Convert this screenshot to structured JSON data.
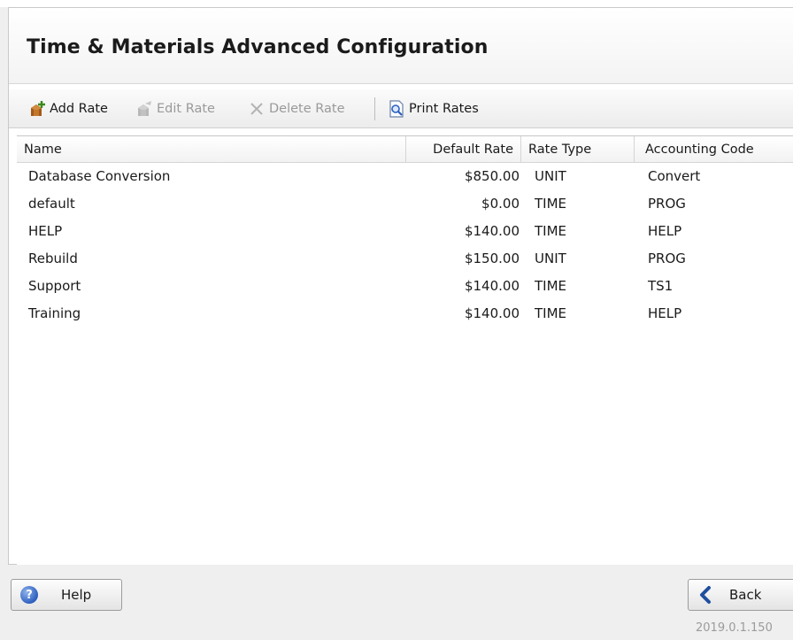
{
  "page": {
    "title": "Time & Materials Advanced Configuration"
  },
  "toolbar": {
    "add_rate": "Add Rate",
    "edit_rate": "Edit Rate",
    "delete_rate": "Delete Rate",
    "print_rates": "Print Rates"
  },
  "table": {
    "columns": [
      "Name",
      "Default Rate",
      "Rate Type",
      "Accounting Code"
    ],
    "rows": [
      {
        "name": "Database Conversion",
        "default_rate": "$850.00",
        "rate_type": "UNIT",
        "accounting_code": "Convert"
      },
      {
        "name": "default",
        "default_rate": "$0.00",
        "rate_type": "TIME",
        "accounting_code": "PROG"
      },
      {
        "name": "HELP",
        "default_rate": "$140.00",
        "rate_type": "TIME",
        "accounting_code": "HELP"
      },
      {
        "name": "Rebuild",
        "default_rate": "$150.00",
        "rate_type": "UNIT",
        "accounting_code": "PROG"
      },
      {
        "name": "Support",
        "default_rate": "$140.00",
        "rate_type": "TIME",
        "accounting_code": "TS1"
      },
      {
        "name": "Training",
        "default_rate": "$140.00",
        "rate_type": "TIME",
        "accounting_code": "HELP"
      }
    ]
  },
  "footer": {
    "help_label": "Help",
    "back_label": "Back",
    "version": "2019.0.1.150"
  },
  "icons": {
    "add": "add-rate-icon",
    "edit": "edit-rate-icon",
    "delete": "delete-x-icon",
    "print": "print-preview-icon",
    "help": "help-question-icon",
    "back": "back-arrow-icon"
  },
  "colors": {
    "accent_blue": "#2d5fbf",
    "disabled_text": "#9a9a9a"
  }
}
